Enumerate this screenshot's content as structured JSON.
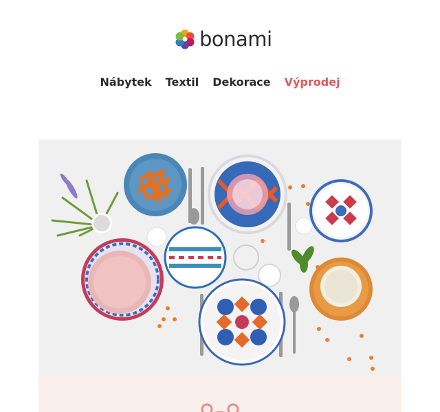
{
  "brand": {
    "name": "bonami",
    "logo_icon": "flower-logo-icon",
    "colors": {
      "text": "#2b2b2b",
      "sale": "#e0585e",
      "promo_bg": "#f9f0eb"
    }
  },
  "nav": {
    "items": [
      {
        "label": "Nábytek"
      },
      {
        "label": "Textil"
      },
      {
        "label": "Dekorace"
      },
      {
        "label": "Výprodej"
      }
    ]
  },
  "promo": {
    "icon": "bear-icon"
  }
}
